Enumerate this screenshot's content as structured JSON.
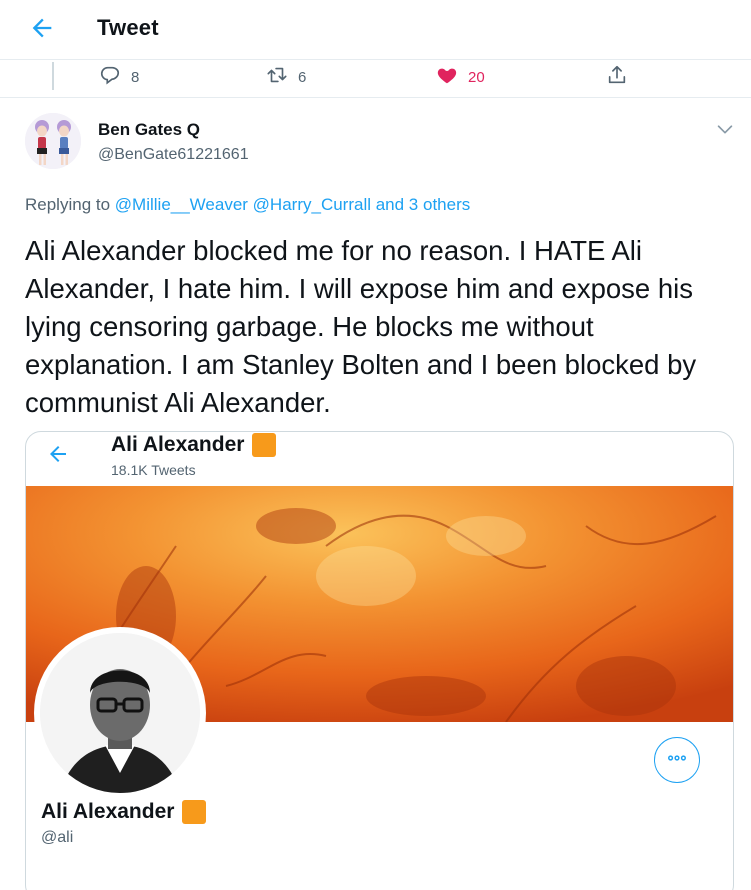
{
  "header": {
    "title": "Tweet"
  },
  "prev_tweet_actions": {
    "reply_count": "8",
    "retweet_count": "6",
    "like_count": "20"
  },
  "tweet": {
    "author_name": "Ben Gates Q",
    "author_handle": "@BenGate61221661",
    "replying_prefix": "Replying to",
    "replying_to": "@Millie__Weaver @Harry_Currall and 3 others",
    "text": "Ali Alexander blocked me for no reason. I HATE Ali Alexander, I hate him. I will expose him and expose his lying censoring garbage. He blocks me without explanation. I am Stanley Bolten and I been blocked by communist Ali Alexander."
  },
  "embedded_profile": {
    "header_name": "Ali Alexander",
    "tweet_count": "18.1K Tweets",
    "profile_name": "Ali Alexander",
    "profile_handle": "@ali"
  },
  "colors": {
    "accent": "#1da1f2",
    "like": "#e0245e",
    "badge": "#f79a1b",
    "banner": "#e86a18"
  }
}
